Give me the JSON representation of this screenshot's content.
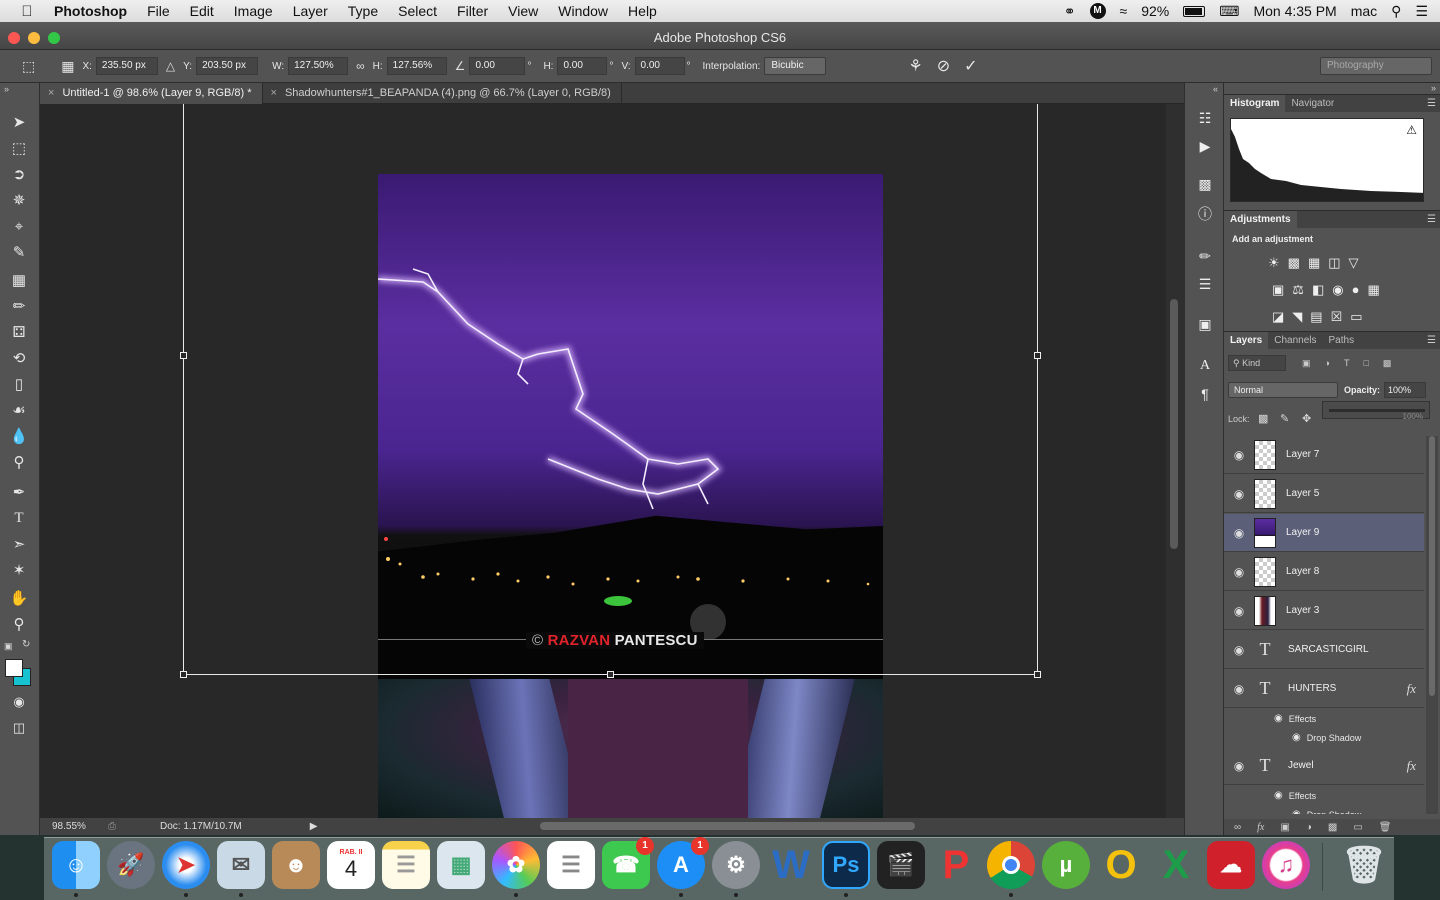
{
  "menubar": {
    "app_name": "Photoshop",
    "items": [
      "File",
      "Edit",
      "Image",
      "Layer",
      "Type",
      "Select",
      "Filter",
      "View",
      "Window",
      "Help"
    ],
    "battery": "92%",
    "clock": "Mon 4:35 PM",
    "user": "mac"
  },
  "window": {
    "title": "Adobe Photoshop CS6"
  },
  "options": {
    "x_label": "X:",
    "x_value": "235.50 px",
    "y_label": "Y:",
    "y_value": "203.50 px",
    "w_label": "W:",
    "w_value": "127.50%",
    "h_label": "H:",
    "h_value": "127.56%",
    "angle_value": "0.00",
    "deg": "°",
    "hskew_label": "H:",
    "hskew_value": "0.00",
    "vskew_label": "V:",
    "vskew_value": "0.00",
    "interp_label": "Interpolation:",
    "interp_value": "Bicubic",
    "workspace": "Photography"
  },
  "tabs": [
    {
      "label": "Untitled-1 @ 98.6% (Layer 9, RGB/8) *",
      "active": true
    },
    {
      "label": "Shadowhunters#1_BEAPANDA (4).png @ 66.7% (Layer 0, RGB/8)",
      "active": false
    }
  ],
  "canvas": {
    "watermark_red": "RAZVAN",
    "watermark_white": "PANTESCU",
    "copyright": "©"
  },
  "status": {
    "zoom": "98.55%",
    "doc": "Doc: 1.17M/10.7M"
  },
  "panels": {
    "top_tabs": [
      "Histogram",
      "Navigator"
    ],
    "adjustments_title": "Adjustments",
    "add_adjustment": "Add an adjustment",
    "layer_tabs": [
      "Layers",
      "Channels",
      "Paths"
    ],
    "kind": "Kind",
    "blend": "Normal",
    "opacity_label": "Opacity:",
    "opacity_value": "100%",
    "lock_label": "Lock:",
    "fill_value": "100%"
  },
  "layers": [
    {
      "name": "Layer 7",
      "kind": "pixel",
      "selected": false,
      "fx": false
    },
    {
      "name": "Layer 5",
      "kind": "pixel",
      "selected": false,
      "fx": false
    },
    {
      "name": "Layer 9",
      "kind": "pixel",
      "selected": true,
      "fx": false
    },
    {
      "name": "Layer 8",
      "kind": "pixel",
      "selected": false,
      "fx": false
    },
    {
      "name": "Layer 3",
      "kind": "pixel",
      "selected": false,
      "fx": false
    },
    {
      "name": "SARCASTICGIRL",
      "kind": "text",
      "selected": false,
      "fx": false
    },
    {
      "name": "HUNTERS",
      "kind": "text",
      "selected": false,
      "fx": true
    },
    {
      "name": "Jewel",
      "kind": "text",
      "selected": false,
      "fx": true
    }
  ],
  "layer_effects": {
    "effects": "Effects",
    "drop_shadow": "Drop Shadow",
    "fx": "fx"
  },
  "dock": {
    "calendar_month": "RAB. II",
    "calendar_day": "4",
    "facetime_badge": "1",
    "appstore_badge": "1",
    "ps_label": "Ps",
    "word_label": "W"
  },
  "colors": {
    "accent_selected": "#5b6078",
    "watermark_red": "#e0222b",
    "sky": "#5b2ea0"
  }
}
